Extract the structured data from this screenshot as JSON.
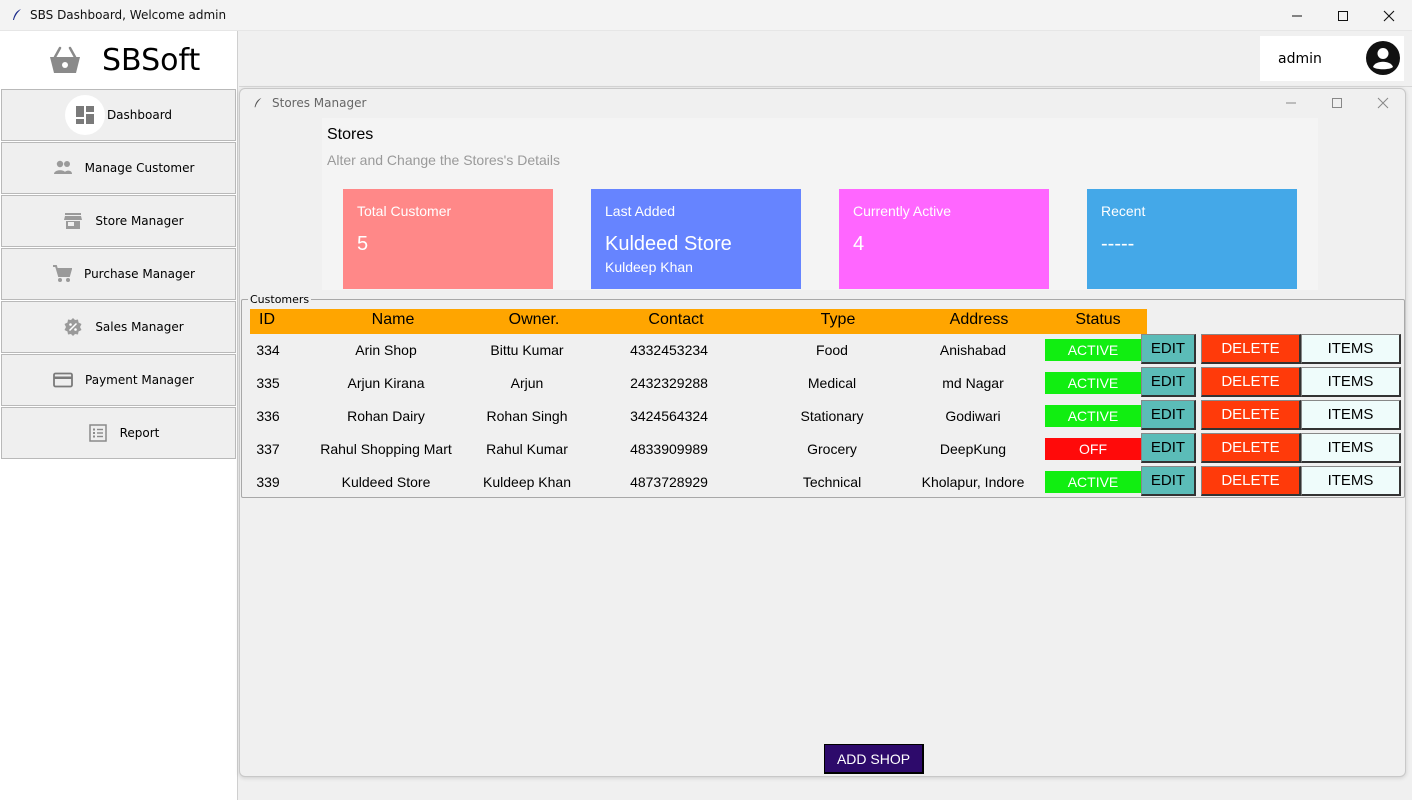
{
  "window": {
    "title": "SBS Dashboard, Welcome admin"
  },
  "sidebar": {
    "brand": "SBSoft",
    "items": [
      {
        "label": "Dashboard",
        "icon": "dashboard-icon"
      },
      {
        "label": "Manage Customer",
        "icon": "people-icon"
      },
      {
        "label": "Store Manager",
        "icon": "store-icon"
      },
      {
        "label": "Purchase Manager",
        "icon": "cart-icon"
      },
      {
        "label": "Sales Manager",
        "icon": "discount-icon"
      },
      {
        "label": "Payment Manager",
        "icon": "credit-card-icon"
      },
      {
        "label": "Report",
        "icon": "report-list-icon"
      }
    ]
  },
  "user": {
    "name": "admin",
    "icon": "account-circle-icon"
  },
  "store_window": {
    "title": "Stores Manager",
    "heading": "Stores",
    "subheading": "Alter and Change the Stores's Details",
    "cards": [
      {
        "title": "Total Customer",
        "value": "5",
        "sub": "",
        "color": "#ff8888"
      },
      {
        "title": "Last Added",
        "value": "Kuldeed Store",
        "sub": "Kuldeep Khan",
        "color": "#6684ff"
      },
      {
        "title": "Currently Active",
        "value": "4",
        "sub": "",
        "color": "#ff66ff"
      },
      {
        "title": "Recent",
        "value": "-----",
        "sub": "",
        "color": "#44a8e8"
      }
    ],
    "table": {
      "legend": "Customers",
      "headers": [
        "ID",
        "Name",
        "Owner.",
        "Contact",
        "Type",
        "Address",
        "Status"
      ],
      "rows": [
        {
          "id": "334",
          "name": "Arin Shop",
          "owner": "Bittu Kumar",
          "contact": "4332453234",
          "type": "Food",
          "address": "Anishabad",
          "status": "ACTIVE"
        },
        {
          "id": "335",
          "name": "Arjun Kirana",
          "owner": "Arjun",
          "contact": "2432329288",
          "type": "Medical",
          "address": "md Nagar",
          "status": "ACTIVE"
        },
        {
          "id": "336",
          "name": "Rohan Dairy",
          "owner": "Rohan Singh",
          "contact": "3424564324",
          "type": "Stationary",
          "address": "Godiwari",
          "status": "ACTIVE"
        },
        {
          "id": "337",
          "name": "Rahul Shopping Mart",
          "owner": "Rahul Kumar",
          "contact": "4833909989",
          "type": "Grocery",
          "address": "DeepKung",
          "status": "OFF"
        },
        {
          "id": "339",
          "name": "Kuldeed Store",
          "owner": "Kuldeep Khan",
          "contact": "4873728929",
          "type": "Technical",
          "address": "Kholapur, Indore",
          "status": "ACTIVE"
        }
      ],
      "actions": {
        "edit": "EDIT",
        "delete": "DELETE",
        "items": "ITEMS"
      },
      "status_colors": {
        "ACTIVE": "#11ee11",
        "OFF": "#ff0a0a"
      },
      "header_color": "#ffa500"
    },
    "add_button": "ADD SHOP"
  }
}
